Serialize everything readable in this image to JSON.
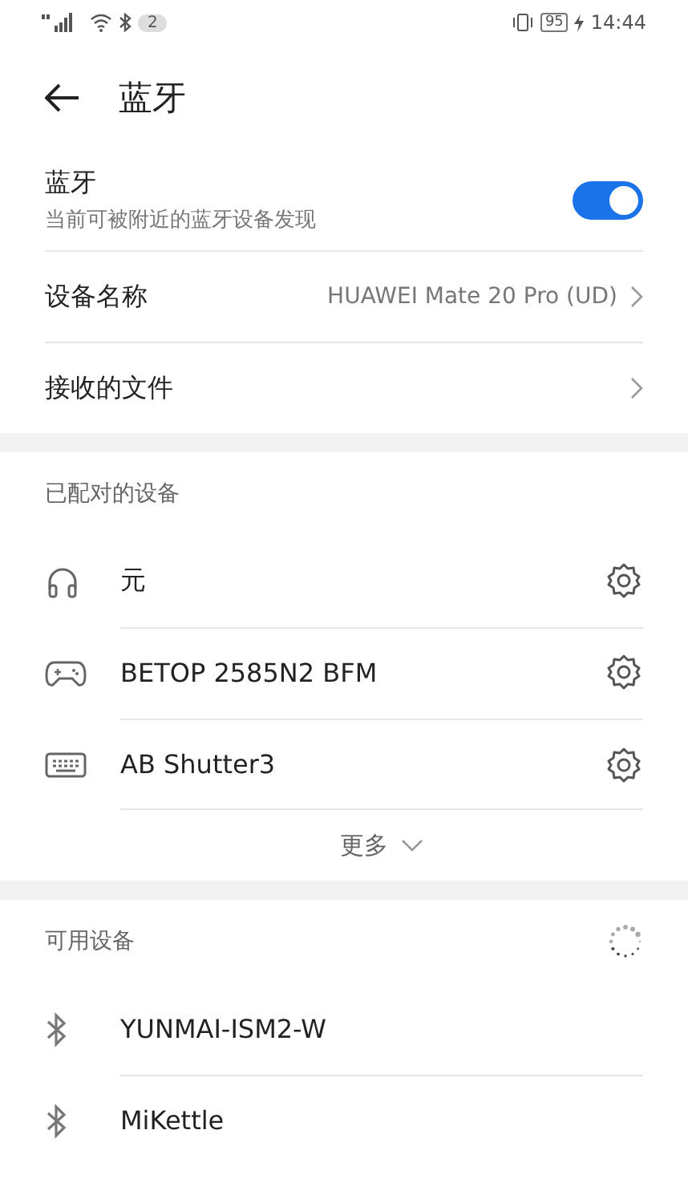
{
  "status_bar": {
    "notification_count": "2",
    "battery": "95",
    "time": "14:44"
  },
  "header": {
    "title": "蓝牙"
  },
  "bluetooth": {
    "label": "蓝牙",
    "description": "当前可被附近的蓝牙设备发现",
    "on": true
  },
  "settings": [
    {
      "label": "设备名称",
      "value": "HUAWEI Mate 20 Pro (UD)"
    },
    {
      "label": "接收的文件"
    }
  ],
  "paired": {
    "title": "已配对的设备",
    "devices": [
      {
        "name": "元",
        "kind": "headphones"
      },
      {
        "name": "BETOP 2585N2 BFM",
        "kind": "gamepad"
      },
      {
        "name": "AB Shutter3",
        "kind": "keyboard"
      }
    ],
    "more": "更多"
  },
  "available": {
    "title": "可用设备",
    "scanning": true,
    "devices": [
      {
        "name": "YUNMAI-ISM2-W",
        "kind": "bluetooth"
      },
      {
        "name": "MiKettle",
        "kind": "bluetooth"
      }
    ]
  }
}
